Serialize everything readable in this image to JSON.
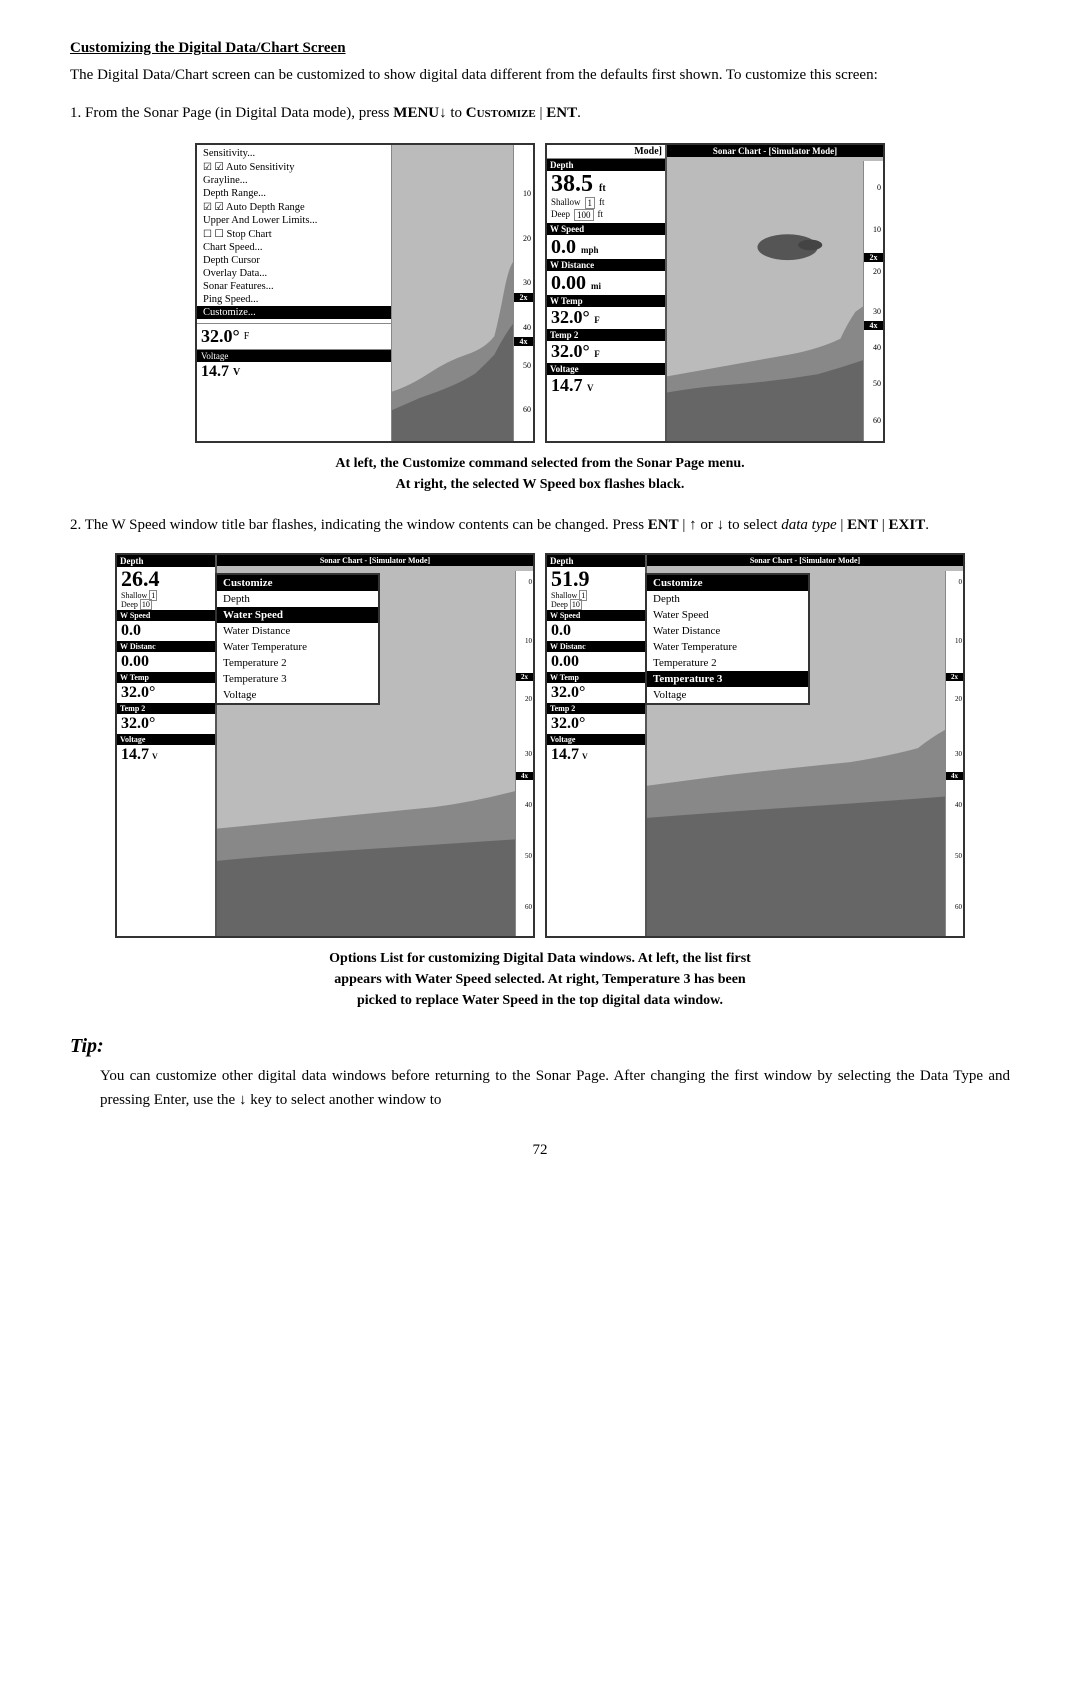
{
  "heading": "Customizing the Digital Data/Chart Screen",
  "intro": "The Digital Data/Chart screen can be customized to show digital data different from the defaults first shown. To customize this screen:",
  "step1": {
    "text_pre": "1.  From the Sonar Page (in Digital Data mode), press ",
    "menu_key": "MENU",
    "down_arrow": "↓",
    "text_mid": " to ",
    "customize_label": "Customize",
    "pipe1": " | ",
    "ent_label": "ENT",
    "text_end": "."
  },
  "left_screen": {
    "menu_items": [
      {
        "label": "Sensitivity...",
        "type": "normal"
      },
      {
        "label": "Auto Sensitivity",
        "type": "checked"
      },
      {
        "label": "Grayline...",
        "type": "normal"
      },
      {
        "label": "Depth Range...",
        "type": "normal"
      },
      {
        "label": "Auto Depth Range",
        "type": "checked"
      },
      {
        "label": "Upper And Lower Limits...",
        "type": "normal"
      },
      {
        "label": "Stop Chart",
        "type": "unchecked"
      },
      {
        "label": "Chart Speed...",
        "type": "normal"
      },
      {
        "label": "Depth Cursor",
        "type": "normal"
      },
      {
        "label": "Overlay Data...",
        "type": "normal"
      },
      {
        "label": "Sonar Features...",
        "type": "normal"
      },
      {
        "label": "Ping Speed...",
        "type": "normal"
      },
      {
        "label": "Customize...",
        "type": "selected"
      }
    ],
    "temp_val": "32.0°",
    "temp_unit": "F",
    "voltage_label": "Voltage",
    "voltage_val": "14.7",
    "voltage_unit": "V",
    "scale_nums": [
      "10",
      "20",
      "30",
      "40",
      "50",
      "60"
    ]
  },
  "right_screen": {
    "title": "Mode]",
    "depth_header": "Depth",
    "depth_val": "38.5",
    "depth_unit": "ft",
    "shallow_label": "Shallow",
    "shallow_val": "1",
    "shallow_unit": "ft",
    "deep_label": "Deep",
    "deep_val": "100",
    "deep_unit": "ft",
    "wspeed_label": "W Speed",
    "wspeed_val": "0.0",
    "wspeed_unit": "mph",
    "wdist_label": "W Distance",
    "wdist_val": "0.00",
    "wdist_unit": "mi",
    "wtemp_label": "W Temp",
    "wtemp_val": "32.0°",
    "wtemp_unit": "F",
    "temp2_label": "Temp 2",
    "temp2_val": "32.0°",
    "temp2_unit": "F",
    "voltage_label": "Voltage",
    "voltage_val": "14.7",
    "voltage_unit": "V",
    "chart_title": "Sonar Chart - [Simulator Mode]",
    "scale_nums": [
      "10",
      "20",
      "30",
      "40",
      "50",
      "60"
    ],
    "zoom_badges": [
      "2x",
      "4x"
    ]
  },
  "caption1_line1": "At left, the Customize command selected from the Sonar Page menu.",
  "caption1_line2": "At right, the selected W Speed box flashes black.",
  "step2": {
    "text1": "2.  The W Speed window title bar flashes, indicating the window contents can be changed. Press ",
    "ent1": "ENT",
    "pipe1": " | ",
    "up_arrow": "↑",
    "text2": " or ",
    "down_arrow": "↓",
    "text3": " to select ",
    "data_type": "data type",
    "pipe2": " | ",
    "ent2": "ENT",
    "pipe3": " | ",
    "exit": "EXIT",
    "text4": "."
  },
  "screen2_left": {
    "depth_val": "26.4",
    "shallow_val": "1",
    "deep_val": "10",
    "wspeed_label": "W Speed",
    "wspeed_val": "0.0",
    "wdist_label": "W Distanc",
    "wdist_val": "0.00",
    "wtemp_label": "W Temp",
    "wtemp_val": "32.0°",
    "temp2_label": "Temp 2",
    "temp2_val": "32.0°",
    "voltage_label": "Voltage",
    "voltage_val": "14.7",
    "chart_title": "Sonar Chart - [Simulator Mode]",
    "dropdown_title": "Customize",
    "dropdown_items": [
      {
        "label": "Depth",
        "selected": false
      },
      {
        "label": "Water Speed",
        "selected": true
      },
      {
        "label": "Water Distance",
        "selected": false
      },
      {
        "label": "Water Temperature",
        "selected": false
      },
      {
        "label": "Temperature 2",
        "selected": false
      },
      {
        "label": "Temperature 3",
        "selected": false
      },
      {
        "label": "Voltage",
        "selected": false
      }
    ]
  },
  "screen2_right": {
    "depth_val": "51.9",
    "shallow_val": "1",
    "deep_val": "10",
    "wspeed_label": "W Speed",
    "wspeed_val": "0.0",
    "wdist_label": "W Distanc",
    "wdist_val": "0.00",
    "wtemp_label": "W Temp",
    "wtemp_val": "32.0°",
    "temp2_label": "Temp 2",
    "temp2_val": "32.0°",
    "voltage_label": "Voltage",
    "voltage_val": "14.7",
    "chart_title": "Sonar Chart - [Simulator Mode]",
    "dropdown_title": "Customize",
    "dropdown_items": [
      {
        "label": "Depth",
        "selected": false
      },
      {
        "label": "Water Speed",
        "selected": false
      },
      {
        "label": "Water Distance",
        "selected": false
      },
      {
        "label": "Water Temperature",
        "selected": false
      },
      {
        "label": "Temperature 2",
        "selected": false
      },
      {
        "label": "Temperature 3",
        "selected": true
      },
      {
        "label": "Voltage",
        "selected": false
      }
    ]
  },
  "caption2_line1": "Options List for customizing Digital Data windows. At left, the list first",
  "caption2_line2": "appears with Water Speed selected. At right, Temperature 3 has been",
  "caption2_line3": "picked to replace Water Speed in the top digital data window.",
  "tip_heading": "Tip:",
  "tip_body": "You can customize other digital data windows before returning to the Sonar Page. After changing the first window by selecting the Data Type and pressing Enter, use the ↓ key to select another window to",
  "page_number": "72"
}
